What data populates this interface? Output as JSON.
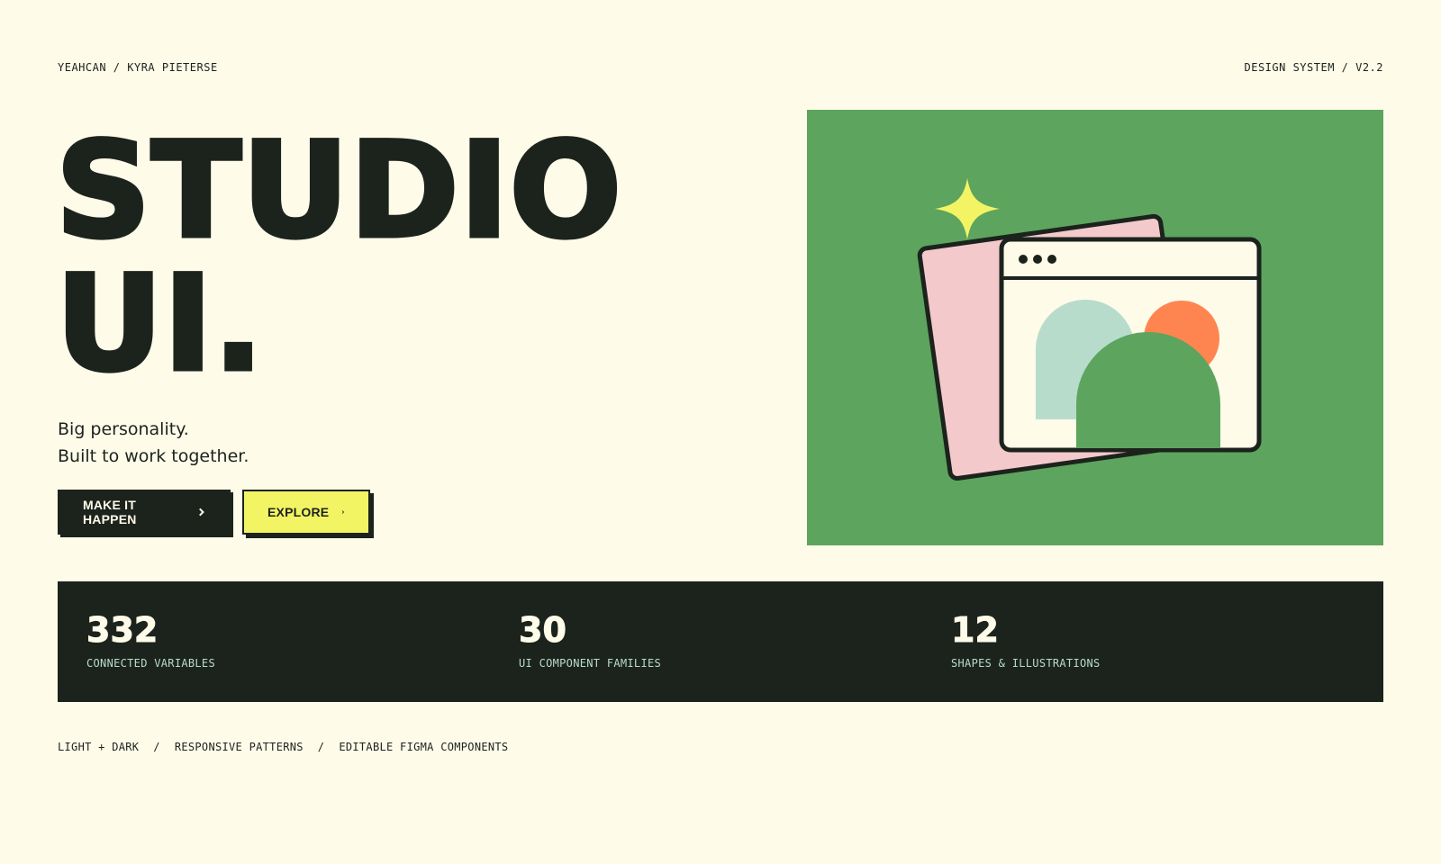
{
  "header": {
    "brand": "YEAHCAN / KYRA PIETERSE",
    "version": "DESIGN SYSTEM / V2.2"
  },
  "hero": {
    "title_line1": "STUDIO",
    "title_line2": "UI.",
    "tagline_line1": "Big personality.",
    "tagline_line2": "Built to work together.",
    "primary_button": "MAKE IT HAPPEN",
    "secondary_button": "EXPLORE"
  },
  "illustration": {
    "icons": [
      "sparkle-icon",
      "pink-card",
      "browser-window-icon",
      "arch-shape",
      "circle-shape"
    ]
  },
  "stats": [
    {
      "value": "332",
      "label": "CONNECTED VARIABLES"
    },
    {
      "value": "30",
      "label": "UI COMPONENT FAMILIES"
    },
    {
      "value": "12",
      "label": "SHAPES & ILLUSTRATIONS"
    }
  ],
  "footer": {
    "tags": [
      "LIGHT + DARK",
      "/",
      "RESPONSIVE PATTERNS",
      "/",
      "EDITABLE FIGMA COMPONENTS"
    ]
  },
  "colors": {
    "background": "#fefbe9",
    "ink": "#1c231d",
    "green": "#5da45e",
    "yellow": "#f3f464",
    "pink": "#f4c9cb",
    "mint": "#b8dccc",
    "orange": "#ff8550"
  }
}
